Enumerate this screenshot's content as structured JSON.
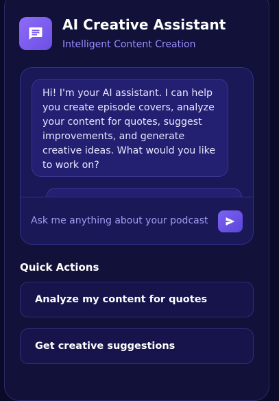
{
  "header": {
    "icon": "message-icon",
    "title": "AI Creative Assistant",
    "subtitle": "Intelligent Content Creation"
  },
  "chat": {
    "messages": [
      {
        "role": "assistant",
        "text": "Hi! I'm your AI assistant. I can help you create episode covers, analyze your content for quotes, suggest improvements, and generate creative ideas. What would you like to work on?"
      }
    ],
    "input": {
      "value": "",
      "placeholder": "Ask me anything about your podcast..."
    },
    "send_icon": "send-icon"
  },
  "quick_actions": {
    "title": "Quick Actions",
    "items": [
      {
        "label": "Analyze my content for quotes"
      },
      {
        "label": "Get creative suggestions"
      }
    ]
  },
  "colors": {
    "background": "#0b0a2a",
    "panel": "#12113a",
    "chat_box": "#1b1858",
    "bubble": "#232072",
    "accent": "#7b63f3",
    "subtitle": "#9b8cff"
  }
}
